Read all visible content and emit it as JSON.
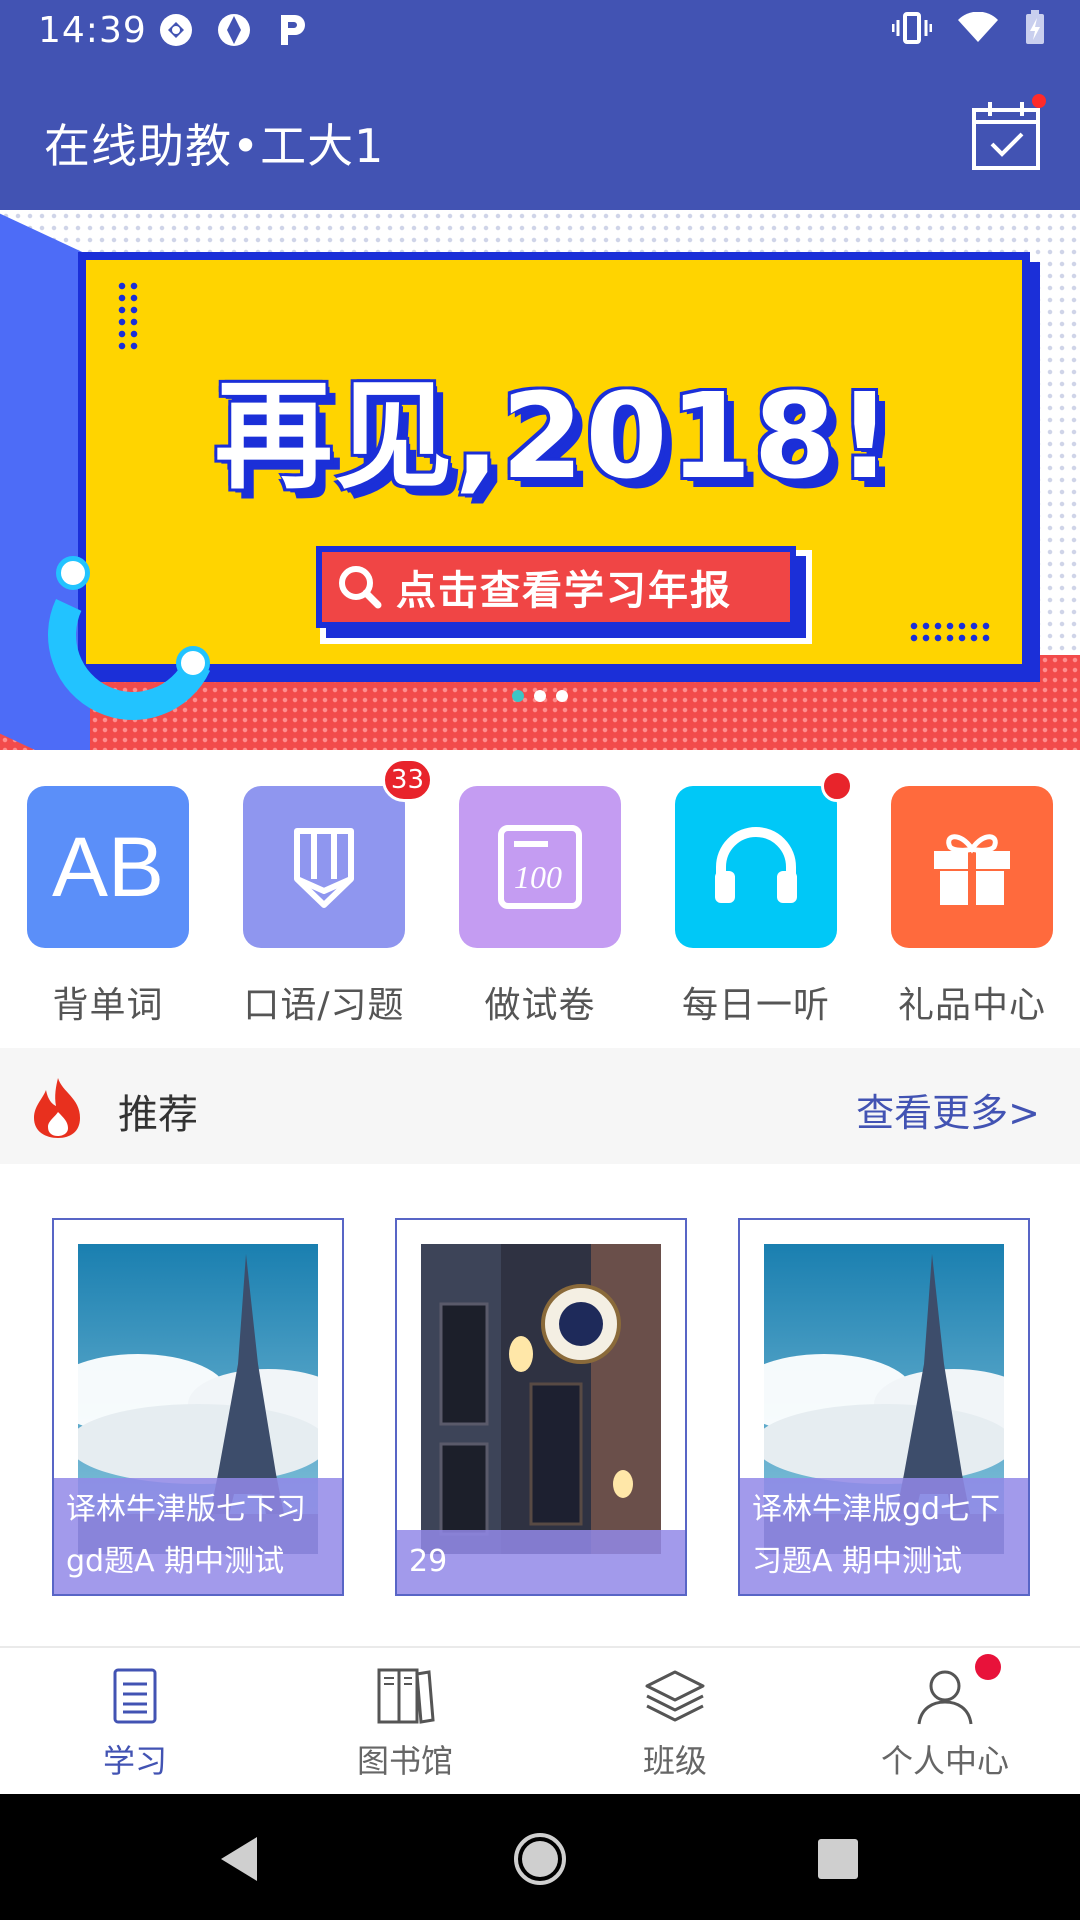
{
  "status_bar": {
    "time": "14:39"
  },
  "app_bar": {
    "title": "在线助教•工大1"
  },
  "banner": {
    "headline": "再见,2018!",
    "cta_text": "点击查看学习年报",
    "page_count": 3,
    "active_page": 1
  },
  "features": [
    {
      "label": "背单词",
      "icon_text": "AB",
      "color": "#5b8ff9"
    },
    {
      "label": "口语/习题",
      "badge": "33",
      "color": "#8f96ef"
    },
    {
      "label": "做试卷",
      "icon_text": "100",
      "color": "#c49cf2"
    },
    {
      "label": "每日一听",
      "has_dot": true,
      "color": "#00c8f7"
    },
    {
      "label": "礼品中心",
      "color": "#ff6a3d"
    }
  ],
  "recommend": {
    "title": "推荐",
    "more": "查看更多>"
  },
  "cards": [
    {
      "caption": "译林牛津版七下习gd题A 期中测试",
      "image": "eiffel-tower-photo"
    },
    {
      "caption": "29",
      "image": "pub-sign-photo"
    },
    {
      "caption": "译林牛津版gd七下习题A 期中测试",
      "image": "eiffel-tower-photo"
    }
  ],
  "bottom_nav": [
    {
      "label": "学习",
      "active": true
    },
    {
      "label": "图书馆"
    },
    {
      "label": "班级"
    },
    {
      "label": "个人中心",
      "has_dot": true
    }
  ]
}
